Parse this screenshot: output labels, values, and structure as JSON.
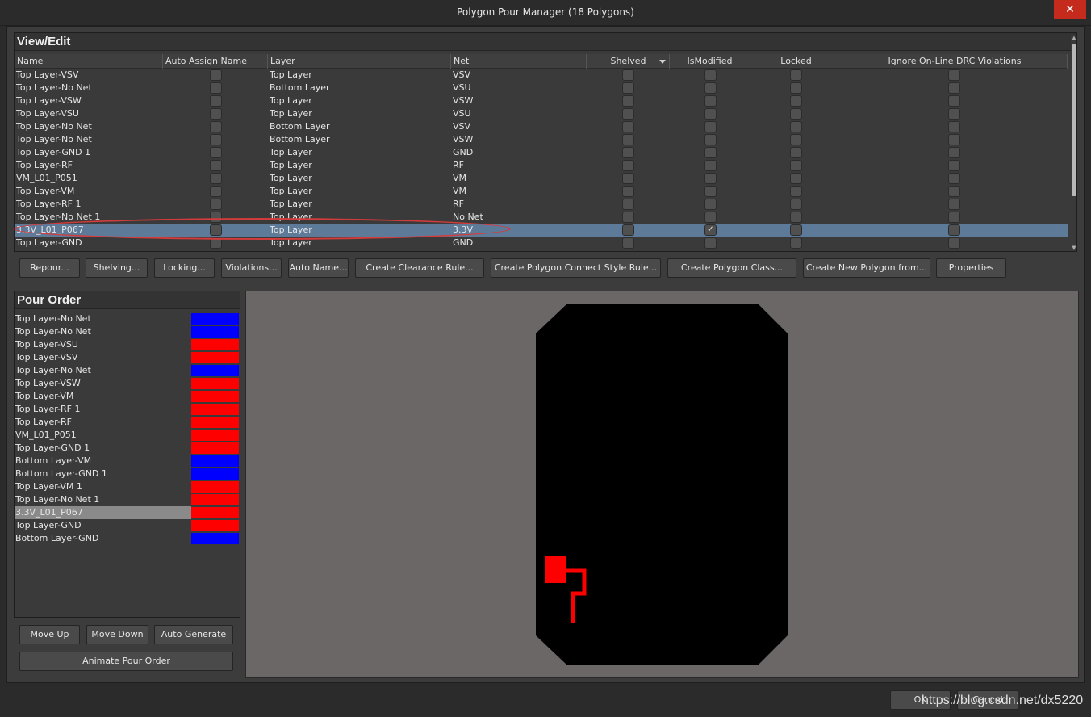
{
  "window": {
    "title": "Polygon Pour Manager (18 Polygons)",
    "close_glyph": "✕"
  },
  "view_edit": {
    "title": "View/Edit",
    "columns": [
      "Name",
      "Auto Assign Name",
      "Layer",
      "Net",
      "Shelved",
      "IsModified",
      "Locked",
      "Ignore On-Line DRC Violations"
    ],
    "rows": [
      {
        "name": "Top Layer-VSV",
        "layer": "Top Layer",
        "net": "VSV",
        "is_modified": false
      },
      {
        "name": "Top Layer-No Net",
        "layer": "Bottom Layer",
        "net": "VSU",
        "is_modified": false
      },
      {
        "name": "Top Layer-VSW",
        "layer": "Top Layer",
        "net": "VSW",
        "is_modified": false
      },
      {
        "name": "Top Layer-VSU",
        "layer": "Top Layer",
        "net": "VSU",
        "is_modified": false
      },
      {
        "name": "Top Layer-No Net",
        "layer": "Bottom Layer",
        "net": "VSV",
        "is_modified": false
      },
      {
        "name": "Top Layer-No Net",
        "layer": "Bottom Layer",
        "net": "VSW",
        "is_modified": false
      },
      {
        "name": "Top Layer-GND 1",
        "layer": "Top Layer",
        "net": "GND",
        "is_modified": false
      },
      {
        "name": "Top Layer-RF",
        "layer": "Top Layer",
        "net": "RF",
        "is_modified": false
      },
      {
        "name": "VM_L01_P051",
        "layer": "Top Layer",
        "net": "VM",
        "is_modified": false
      },
      {
        "name": "Top Layer-VM",
        "layer": "Top Layer",
        "net": "VM",
        "is_modified": false
      },
      {
        "name": "Top Layer-RF 1",
        "layer": "Top Layer",
        "net": "RF",
        "is_modified": false
      },
      {
        "name": "Top Layer-No Net 1",
        "layer": "Top Layer",
        "net": "No Net",
        "is_modified": false
      },
      {
        "name": "3.3V_L01_P067",
        "layer": "Top Layer",
        "net": "3.3V",
        "is_modified": true,
        "selected": true
      },
      {
        "name": "Top Layer-GND",
        "layer": "Top Layer",
        "net": "GND",
        "is_modified": false
      }
    ],
    "check_glyph": "✓"
  },
  "action_buttons": [
    "Repour...",
    "Shelving...",
    "Locking...",
    "Violations...",
    "Auto Name...",
    "Create Clearance Rule...",
    "Create Polygon Connect Style Rule...",
    "Create Polygon Class...",
    "Create New Polygon from...",
    "Properties"
  ],
  "pour_order": {
    "title": "Pour Order",
    "items": [
      {
        "label": "Top Layer-No Net",
        "color": "#0000ff"
      },
      {
        "label": "Top Layer-No Net",
        "color": "#0000ff"
      },
      {
        "label": "Top Layer-VSU",
        "color": "#ff0000"
      },
      {
        "label": "Top Layer-VSV",
        "color": "#ff0000"
      },
      {
        "label": "Top Layer-No Net",
        "color": "#0000ff"
      },
      {
        "label": "Top Layer-VSW",
        "color": "#ff0000"
      },
      {
        "label": "Top Layer-VM",
        "color": "#ff0000"
      },
      {
        "label": "Top Layer-RF 1",
        "color": "#ff0000"
      },
      {
        "label": "Top Layer-RF",
        "color": "#ff0000"
      },
      {
        "label": "VM_L01_P051",
        "color": "#ff0000"
      },
      {
        "label": "Top Layer-GND 1",
        "color": "#ff0000"
      },
      {
        "label": "Bottom Layer-VM",
        "color": "#0000ff"
      },
      {
        "label": "Bottom Layer-GND 1",
        "color": "#0000ff"
      },
      {
        "label": "Top Layer-VM 1",
        "color": "#ff0000"
      },
      {
        "label": "Top Layer-No Net 1",
        "color": "#ff0000"
      },
      {
        "label": "3.3V_L01_P067",
        "color": "#ff0000",
        "selected": true
      },
      {
        "label": "Top Layer-GND",
        "color": "#ff0000"
      },
      {
        "label": "Bottom Layer-GND",
        "color": "#0000ff"
      }
    ],
    "move_up": "Move Up",
    "move_down": "Move Down",
    "auto_generate": "Auto Generate",
    "animate": "Animate Pour Order"
  },
  "preview": {
    "board_color": "#000000",
    "background_color": "#6b6767",
    "highlight_color": "#ff0000"
  },
  "footer": {
    "ok": "OK",
    "cancel": "Cancel",
    "watermark": "https://blog.csdn.net/dx5220"
  }
}
